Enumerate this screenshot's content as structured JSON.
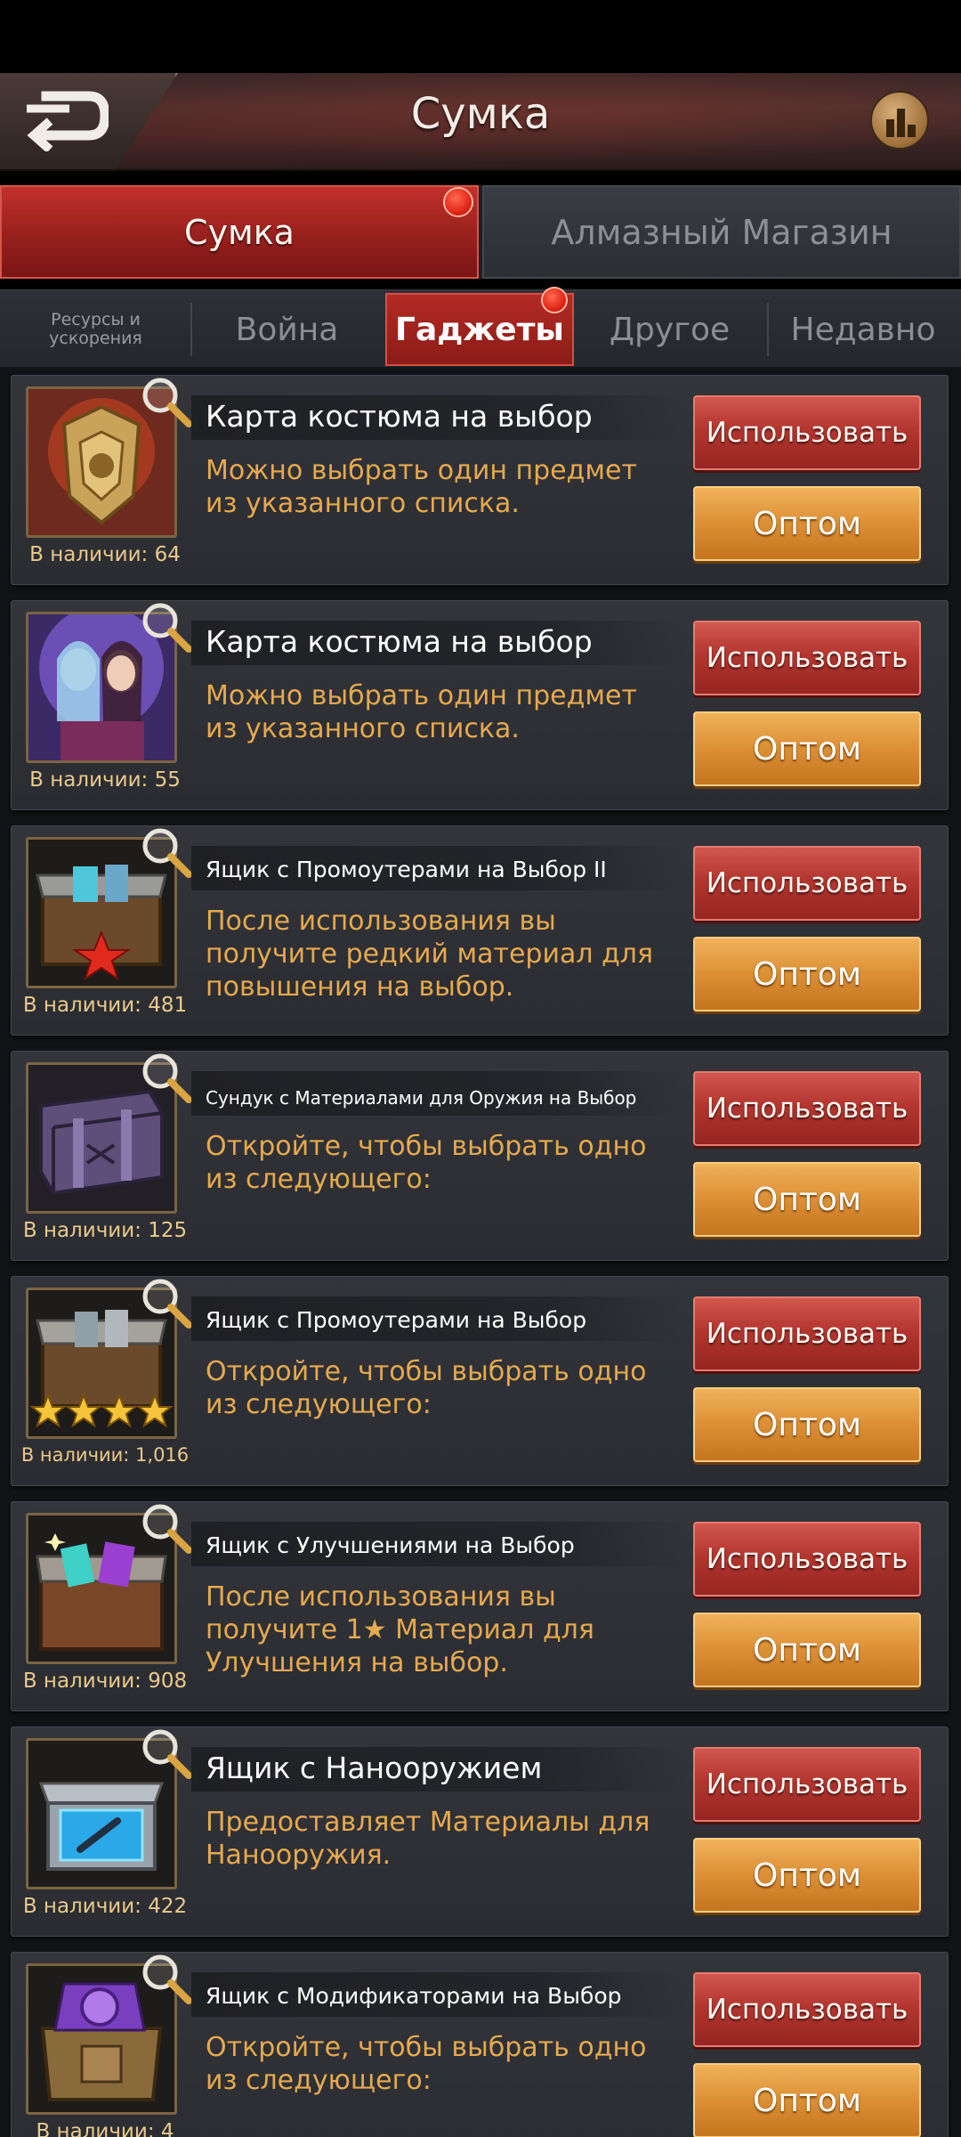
{
  "header": {
    "title": "Сумка"
  },
  "main_tabs": [
    {
      "label": "Сумка",
      "active": true,
      "has_badge": true
    },
    {
      "label": "Алмазный Магазин",
      "active": false,
      "has_badge": false
    }
  ],
  "sub_tabs": {
    "resources": [
      "Ресурсы и",
      "ускорения"
    ],
    "war": "Война",
    "gadgets": "Гаджеты",
    "other": "Другое",
    "recent": "Недавно"
  },
  "buttons": {
    "use_label": "Использовать",
    "bulk_label": "Оптом"
  },
  "items": [
    {
      "name": "Карта костюма на выбор",
      "desc": "Можно выбрать один предмет из указанного списка.",
      "qty": "В наличии: 64",
      "icon": "gold-costume-card-icon"
    },
    {
      "name": "Карта костюма на выбор",
      "desc": "Можно выбрать один предмет из указанного списка.",
      "qty": "В наличии: 55",
      "icon": "character-costume-card-icon"
    },
    {
      "name": "Ящик с Промоутерами на Выбор II",
      "desc": "После использования вы получите редкий материал для повышения на выбор.",
      "qty": "В наличии: 481",
      "icon": "promoter-chest-red-star-icon"
    },
    {
      "name": "Сундук с Материалами для Оружия на Выбор",
      "desc": "Откройте, чтобы выбрать одно из следующего:",
      "qty": "В наличии: 125",
      "icon": "weapon-material-chest-icon"
    },
    {
      "name": "Ящик с Промоутерами на Выбор",
      "desc": "Откройте, чтобы выбрать одно из следующего:",
      "qty": "В наличии: 1,016",
      "icon": "promoter-chest-four-stars-icon"
    },
    {
      "name": "Ящик с Улучшениями на Выбор",
      "desc": "После использования вы получите 1★ Материал для Улучшения на выбор.",
      "qty": "В наличии: 908",
      "icon": "upgrade-chest-icon"
    },
    {
      "name": "Ящик с Нанооружием",
      "desc": "Предоставляет Материалы для Нанооружия.",
      "qty": "В наличии: 422",
      "icon": "nano-weapon-box-icon"
    },
    {
      "name": "Ящик с Модификаторами на Выбор",
      "desc": "Откройте, чтобы выбрать одно из следующего:",
      "qty": "В наличии: 4",
      "icon": "modifier-chest-icon"
    }
  ]
}
